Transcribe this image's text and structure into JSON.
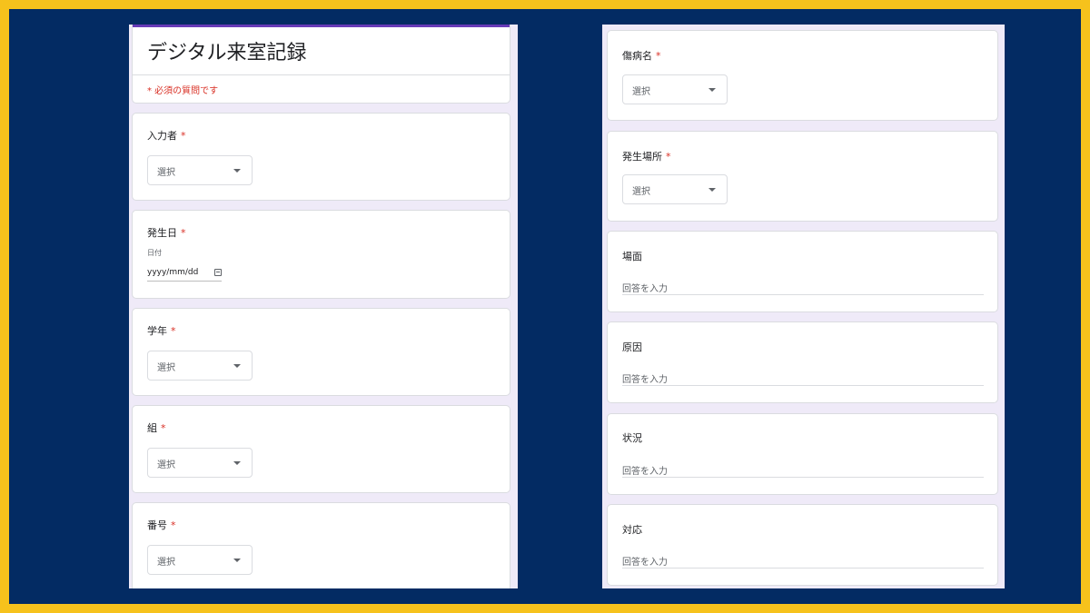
{
  "form": {
    "title": "デジタル来室記録",
    "required_note": "* 必須の質問です"
  },
  "required_mark": "*",
  "left_questions": [
    {
      "label": "入力者",
      "type": "dropdown",
      "required": true,
      "value": "選択"
    },
    {
      "label": "発生日",
      "type": "date",
      "required": true,
      "sublabel": "日付",
      "placeholder": "yyyy/mm/dd"
    },
    {
      "label": "学年",
      "type": "dropdown",
      "required": true,
      "value": "選択"
    },
    {
      "label": "組",
      "type": "dropdown",
      "required": true,
      "value": "選択"
    },
    {
      "label": "番号",
      "type": "dropdown",
      "required": true,
      "value": "選択"
    }
  ],
  "right_questions": [
    {
      "label": "傷病名",
      "type": "dropdown",
      "required": true,
      "value": "選択"
    },
    {
      "label": "発生場所",
      "type": "dropdown",
      "required": true,
      "value": "選択"
    },
    {
      "label": "場面",
      "type": "text",
      "required": false,
      "placeholder": "回答を入力"
    },
    {
      "label": "原因",
      "type": "text",
      "required": false,
      "placeholder": "回答を入力"
    },
    {
      "label": "状況",
      "type": "text",
      "required": false,
      "placeholder": "回答を入力"
    },
    {
      "label": "対応",
      "type": "text",
      "required": false,
      "placeholder": "回答を入力"
    }
  ],
  "colors": {
    "background_frame": "#f6c21c",
    "background": "#032b63",
    "form_background": "#efeaf8",
    "accent": "#673ab7",
    "required": "#d93025"
  },
  "icons": {
    "dropdown": "caret-down-icon",
    "date": "calendar-icon"
  }
}
